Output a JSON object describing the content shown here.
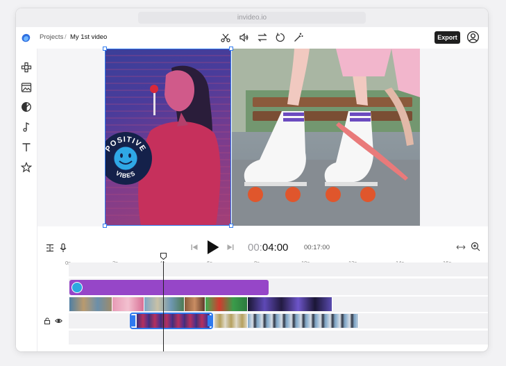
{
  "browser": {
    "url": "invideo.io"
  },
  "header": {
    "breadcrumb": {
      "projects": "Projects",
      "separator": "/",
      "current": "My 1st video"
    },
    "export_label": "Export"
  },
  "toolbar_icons": [
    "scissors-icon",
    "volume-icon",
    "swap-icon",
    "rotate-icon",
    "magic-wand-icon"
  ],
  "sidebar_icons": [
    "elements-icon",
    "media-icon",
    "filter-icon",
    "music-icon",
    "text-icon",
    "star-icon"
  ],
  "sticker": {
    "top_text": "POSITIVE",
    "bottom_text": "VIBES"
  },
  "player": {
    "current_time_dim": "00:",
    "current_time": "04:00",
    "total_time": "00:17:00"
  },
  "ruler": {
    "labels": [
      "0s",
      "2s",
      "4s",
      "6s",
      "8s",
      "10s",
      "12s",
      "14s",
      "16s"
    ]
  },
  "colors": {
    "accent": "#2f7af0",
    "audio_track": "#9646c8",
    "export_button": "#1f1f1f"
  }
}
